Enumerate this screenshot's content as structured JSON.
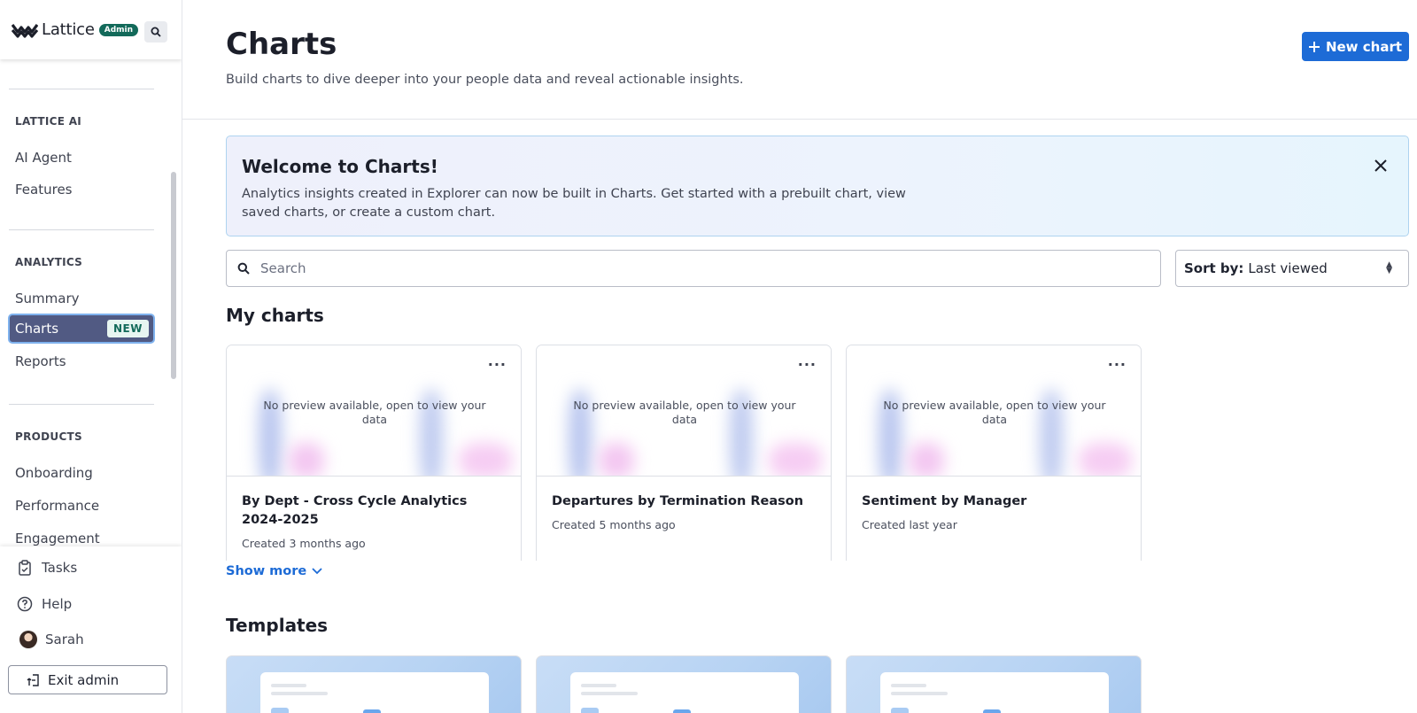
{
  "brand": {
    "name": "Lattice",
    "badge": "Admin"
  },
  "sidebar": {
    "sections": [
      {
        "label": "LATTICE AI",
        "items": [
          "AI Agent",
          "Features"
        ]
      },
      {
        "label": "ANALYTICS",
        "items": [
          "Summary",
          "Charts",
          "Reports"
        ]
      },
      {
        "label": "PRODUCTS",
        "items": [
          "Onboarding",
          "Performance",
          "Engagement"
        ]
      }
    ],
    "active_item": "Charts",
    "active_badge": "NEW",
    "footer": {
      "tasks": "Tasks",
      "help": "Help",
      "user": "Sarah",
      "exit": "Exit admin"
    }
  },
  "header": {
    "title": "Charts",
    "subtitle": "Build charts to dive deeper into your people data and reveal actionable insights.",
    "new_chart": "New chart"
  },
  "welcome": {
    "title": "Welcome to Charts!",
    "body": "Analytics insights created in Explorer can now be built in Charts. Get started with a prebuilt chart, view saved charts, or create a custom chart."
  },
  "search": {
    "placeholder": "Search"
  },
  "sort": {
    "label": "Sort by:",
    "value": "Last viewed"
  },
  "my_charts": {
    "title": "My charts",
    "no_preview": "No preview available, open to view your data",
    "cards": [
      {
        "title": "By Dept - Cross Cycle Analytics 2024-2025",
        "created": "Created 3 months ago"
      },
      {
        "title": "Departures by Termination Reason",
        "created": "Created 5 months ago"
      },
      {
        "title": "Sentiment by Manager",
        "created": "Created last year"
      }
    ],
    "show_more": "Show more"
  },
  "templates": {
    "title": "Templates"
  },
  "colors": {
    "accent": "#1d6bd6",
    "active_nav": "#515a83",
    "badge_green": "#136a5a"
  }
}
